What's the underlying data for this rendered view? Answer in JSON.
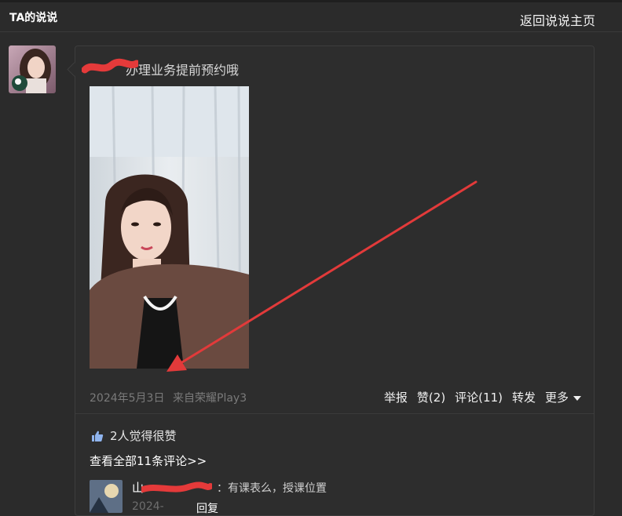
{
  "header": {
    "title": "TA的说说",
    "back_link": "返回说说主页"
  },
  "post": {
    "text_visible": "办理业务提前预约哦",
    "date": "2024年5月3日",
    "source": "来自荣耀Play3",
    "actions": {
      "report": "举报",
      "like": "赞(2)",
      "comment": "评论(11)",
      "forward": "转发",
      "more": "更多"
    }
  },
  "likes": {
    "text": "2人觉得很赞"
  },
  "comments": {
    "view_all": "查看全部11条评论>>",
    "items": [
      {
        "user": "山",
        "text": "：有课表么，授课位置",
        "time": "2024-",
        "reply": "回复"
      }
    ]
  },
  "colors": {
    "background": "#2b2b2b",
    "annotation_red": "#e23a3a"
  }
}
